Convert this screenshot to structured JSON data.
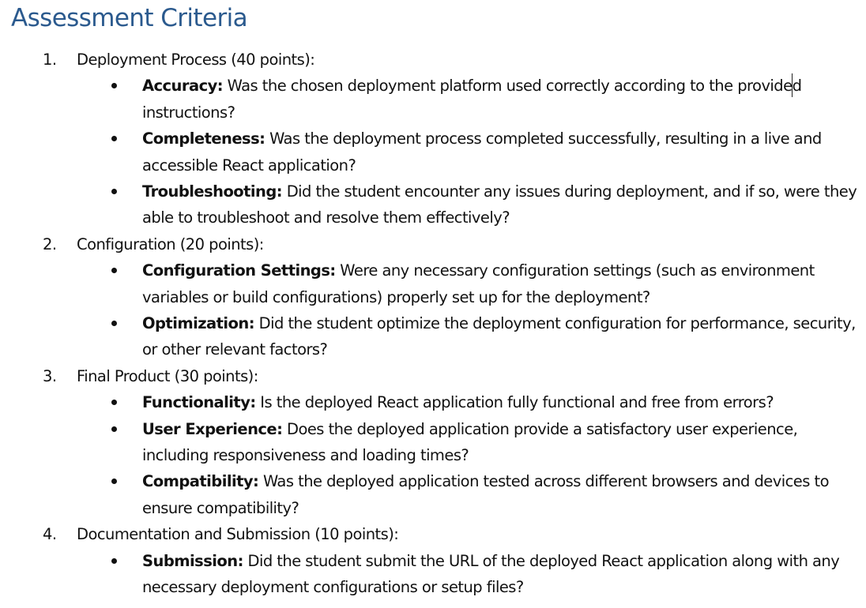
{
  "heading": "Assessment Criteria",
  "sections": [
    {
      "number": "1.",
      "title": "Deployment Process (40 points):",
      "items": [
        {
          "term": "Accuracy:",
          "text": "Was the chosen deployment platform used correctly according to the provided instructions?"
        },
        {
          "term": "Completeness:",
          "text": "Was the deployment process completed successfully, resulting in a live and accessible React application?"
        },
        {
          "term": "Troubleshooting:",
          "text": "Did the student encounter any issues during deployment, and if so, were they able to troubleshoot and resolve them effectively?"
        }
      ]
    },
    {
      "number": "2.",
      "title": "Configuration (20 points):",
      "items": [
        {
          "term": "Configuration Settings:",
          "text": "Were any necessary configuration settings (such as environment variables or build configurations) properly set up for the deployment?"
        },
        {
          "term": "Optimization:",
          "text": "Did the student optimize the deployment configuration for performance, security, or other relevant factors?"
        }
      ]
    },
    {
      "number": "3.",
      "title": "Final Product (30 points):",
      "items": [
        {
          "term": "Functionality:",
          "text": "Is the deployed React application fully functional and free from errors?"
        },
        {
          "term": "User Experience:",
          "text": "Does the deployed application provide a satisfactory user experience, including responsiveness and loading times?"
        },
        {
          "term": "Compatibility:",
          "text": "Was the deployed application tested across different browsers and devices to ensure compatibility?"
        }
      ]
    },
    {
      "number": "4.",
      "title": "Documentation and Submission (10 points):",
      "items": [
        {
          "term": "Submission:",
          "text": "Did the student submit the URL of the deployed React application along with any necessary deployment configurations or setup files?"
        }
      ]
    }
  ]
}
